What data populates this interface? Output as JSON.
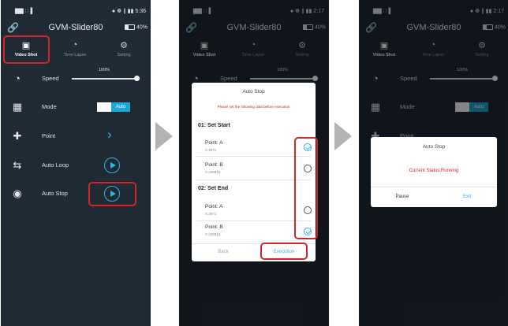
{
  "status": {
    "left": "▇▇ ∷▐",
    "right1": "● ☸ ∥ ▮▮ 5:36",
    "right2": "● ☸ ∥ ▮▮ 2:17",
    "right3": "● ☸ ∥ ▮▮ 2:17"
  },
  "app": {
    "title": "GVM-Slider80",
    "battery": "40%"
  },
  "tabs": [
    {
      "label": "Video Shot",
      "icon": "camera-icon"
    },
    {
      "label": "Time Lapse",
      "icon": "timelapse-icon"
    },
    {
      "label": "Setting",
      "icon": "gear-icon"
    }
  ],
  "speed": {
    "label": "Speed",
    "value": "100%"
  },
  "mode": {
    "label": "Mode",
    "value": "Auto"
  },
  "point": {
    "label": "Point"
  },
  "auto_loop": {
    "label": "Auto Loop"
  },
  "auto_stop": {
    "label": "Auto Stop"
  },
  "dialog1": {
    "title": "Auto Stop",
    "note": "Please set the following data before execution",
    "sections": [
      {
        "title": "01:  Set Start",
        "points": [
          {
            "label": "Point:  A",
            "coord": "X:3671",
            "checked": true
          },
          {
            "label": "Point:  B",
            "coord": "X:328812",
            "checked": false
          }
        ]
      },
      {
        "title": "02:  Set End",
        "points": [
          {
            "label": "Point:  A",
            "coord": "X:3671",
            "checked": false
          },
          {
            "label": "Point:  B",
            "coord": "X:328812",
            "checked": true
          }
        ]
      }
    ],
    "back_label": "Back",
    "execute_label": "Execution"
  },
  "dialog2": {
    "title": "Auto Stop",
    "status": "Current Status:Running",
    "pause_label": "Pause",
    "exit_label": "Exit"
  },
  "colors": {
    "accent": "#2db6e8",
    "highlight": "#d6242e",
    "background": "#1f2a35"
  }
}
